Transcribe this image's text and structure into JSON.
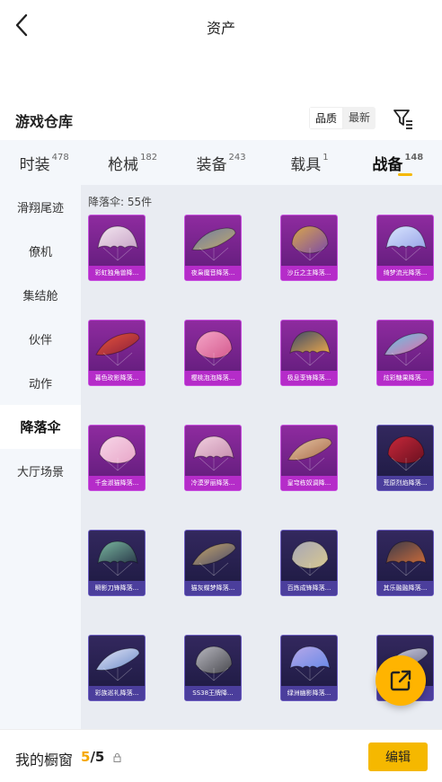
{
  "nav": {
    "title": "资产"
  },
  "section": {
    "title": "游戏仓库",
    "sort_options": [
      "品质",
      "最新"
    ],
    "active_sort": 0
  },
  "colors": {
    "accent": "#f5b800",
    "fab": "#ffb400",
    "purple_card": "#8e2b9f",
    "dark_card": "#2a2252"
  },
  "tabs": [
    {
      "label": "时装",
      "count": "478"
    },
    {
      "label": "枪械",
      "count": "182"
    },
    {
      "label": "装备",
      "count": "243"
    },
    {
      "label": "载具",
      "count": "1"
    },
    {
      "label": "战备",
      "count": "148",
      "active": true
    }
  ],
  "sidebar": {
    "items": [
      {
        "label": "滑翔尾迹"
      },
      {
        "label": "僚机"
      },
      {
        "label": "集结舱"
      },
      {
        "label": "伙伴"
      },
      {
        "label": "动作"
      },
      {
        "label": "降落伞",
        "active": true
      },
      {
        "label": "大厅场景"
      }
    ]
  },
  "grid": {
    "caption": "降落伞: 55件",
    "items": [
      {
        "name": "彩虹独角兽降...",
        "tier": "purple",
        "c1": "#f3e6f0",
        "c2": "#c9a6c8"
      },
      {
        "name": "夜枭魔音降落...",
        "tier": "purple",
        "c1": "#6c7da6",
        "c2": "#c2a86a"
      },
      {
        "name": "沙丘之主降落...",
        "tier": "purple",
        "c1": "#d9a64a",
        "c2": "#7d4ca6"
      },
      {
        "name": "绮梦流光降落...",
        "tier": "purple",
        "c1": "#d9e6ff",
        "c2": "#9aa6e8"
      },
      {
        "name": "暮色玫影降落...",
        "tier": "purple",
        "c1": "#e8553c",
        "c2": "#8a1e3a"
      },
      {
        "name": "樱桃泡泡降落...",
        "tier": "purple",
        "c1": "#f5a6c8",
        "c2": "#d45a8e"
      },
      {
        "name": "极息孪锋降落...",
        "tier": "purple",
        "c1": "#3a4a6a",
        "c2": "#e8a64a"
      },
      {
        "name": "炫彩糖果降落...",
        "tier": "purple",
        "c1": "#5ec8e8",
        "c2": "#e86aa6"
      },
      {
        "name": "千金淑猫降落...",
        "tier": "purple",
        "c1": "#f7d6e8",
        "c2": "#e8a6c8"
      },
      {
        "name": "冷漠罗丽降落...",
        "tier": "purple",
        "c1": "#f2d0e0",
        "c2": "#c890b0"
      },
      {
        "name": "皇穹栋奴调降...",
        "tier": "purple",
        "c1": "#e8c8a6",
        "c2": "#a86a4a"
      },
      {
        "name": "荒原烈焰降落...",
        "tier": "dark",
        "c1": "#c8283a",
        "c2": "#6a1020"
      },
      {
        "name": "瞬影刀锋降落...",
        "tier": "dark",
        "c1": "#7ab8a0",
        "c2": "#2a3a4a"
      },
      {
        "name": "猫灰蝶梦降落...",
        "tier": "dark",
        "c1": "#c8a86a",
        "c2": "#4a4a6a"
      },
      {
        "name": "百炼成锋降落...",
        "tier": "dark",
        "c1": "#a6a6b8",
        "c2": "#d8c890"
      },
      {
        "name": "其乐融融降落...",
        "tier": "dark",
        "c1": "#3a3a4a",
        "c2": "#c86a3a"
      },
      {
        "name": "彩族巡礼降落...",
        "tier": "dark",
        "c1": "#e8e8f8",
        "c2": "#6a8ac8"
      },
      {
        "name": "SS38王牌降...",
        "tier": "dark",
        "c1": "#b8b8c0",
        "c2": "#4a4a50"
      },
      {
        "name": "绿洲幽影降落...",
        "tier": "dark",
        "c1": "#b8a8e8",
        "c2": "#6a8ae8"
      },
      {
        "name": "",
        "tier": "dark",
        "c1": "#d8d8e8",
        "c2": "#6a6a8a"
      }
    ]
  },
  "bottom": {
    "label": "我的橱窗",
    "used": "5",
    "separator": "/",
    "total": "5",
    "edit_label": "编辑"
  }
}
